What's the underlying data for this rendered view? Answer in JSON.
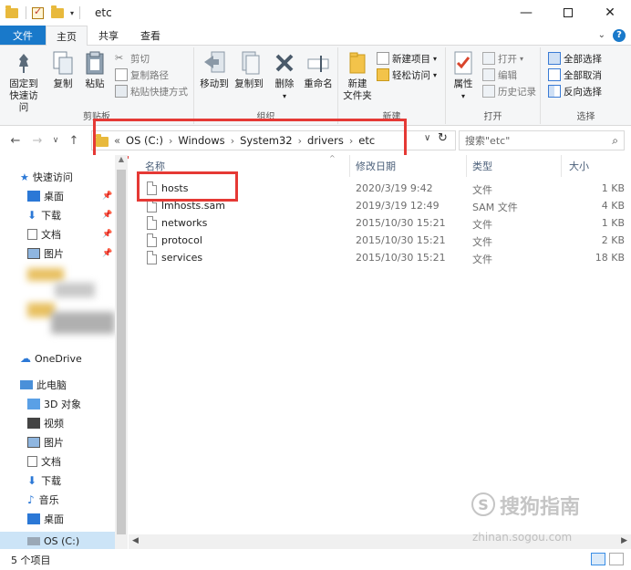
{
  "window": {
    "title": "etc",
    "controls": [
      "minimize-icon",
      "maximize-icon",
      "close-icon"
    ]
  },
  "ribbon_tabs": {
    "file": "文件",
    "home": "主页",
    "share": "共享",
    "view": "查看"
  },
  "ribbon": {
    "clipboard": {
      "pin_quick_access": "固定到\n快速访问",
      "copy": "复制",
      "paste": "粘贴",
      "cut": "剪切",
      "copy_path": "复制路径",
      "paste_shortcut": "粘贴快捷方式",
      "label": "剪贴板"
    },
    "organize": {
      "move_to": "移动到",
      "copy_to": "复制到",
      "delete": "删除",
      "rename": "重命名",
      "label": "组织"
    },
    "new": {
      "new_folder": "新建\n文件夹",
      "new_item": "新建项目",
      "easy_access": "轻松访问",
      "label": "新建"
    },
    "open": {
      "properties": "属性",
      "open": "打开",
      "edit": "编辑",
      "history": "历史记录",
      "label": "打开"
    },
    "select": {
      "select_all": "全部选择",
      "select_none": "全部取消",
      "invert": "反向选择",
      "label": "选择"
    }
  },
  "address": {
    "prefix": "«",
    "crumbs": [
      "OS (C:)",
      "Windows",
      "System32",
      "drivers",
      "etc"
    ]
  },
  "search": {
    "placeholder": "搜索\"etc\""
  },
  "nav": {
    "quick_access": "快速访问",
    "desktop": "桌面",
    "downloads": "下载",
    "documents": "文档",
    "pictures": "图片",
    "onedrive": "OneDrive",
    "this_pc": "此电脑",
    "objects3d": "3D 对象",
    "videos": "视频",
    "pictures2": "图片",
    "documents2": "文档",
    "downloads2": "下载",
    "music": "音乐",
    "desktop2": "桌面",
    "os_drive": "OS (C:)"
  },
  "columns": {
    "name": "名称",
    "date": "修改日期",
    "type": "类型",
    "size": "大小"
  },
  "files": [
    {
      "name": "hosts",
      "date": "2020/3/19 9:42",
      "type": "文件",
      "size": "1 KB"
    },
    {
      "name": "lmhosts.sam",
      "date": "2019/3/19 12:49",
      "type": "SAM 文件",
      "size": "4 KB"
    },
    {
      "name": "networks",
      "date": "2015/10/30 15:21",
      "type": "文件",
      "size": "1 KB"
    },
    {
      "name": "protocol",
      "date": "2015/10/30 15:21",
      "type": "文件",
      "size": "2 KB"
    },
    {
      "name": "services",
      "date": "2015/10/30 15:21",
      "type": "文件",
      "size": "18 KB"
    }
  ],
  "status": {
    "count": "5 个项目"
  },
  "watermark": {
    "brand": "搜狗指南",
    "url": "zhinan.sogou.com"
  },
  "colors": {
    "accent": "#1979ca",
    "highlight": "#e53935",
    "selection": "#cce4f7"
  }
}
